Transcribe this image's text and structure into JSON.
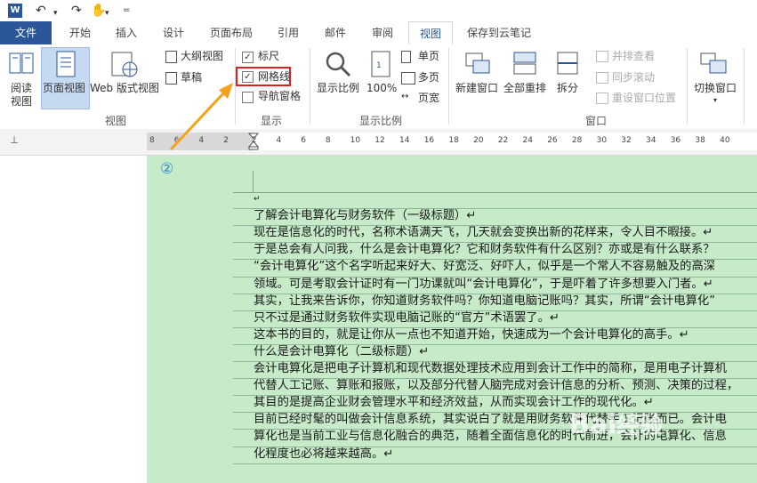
{
  "quick_access": {
    "undo": "↶",
    "redo": "↷",
    "touch": "✋",
    "more": "="
  },
  "tabs": [
    "文件",
    "开始",
    "插入",
    "设计",
    "页面布局",
    "引用",
    "邮件",
    "审阅",
    "视图",
    "保存到云笔记"
  ],
  "active_tab": "视图",
  "ribbon": {
    "views": {
      "read": "阅读\n视图",
      "print": "页面视图",
      "web": "Web 版式视图",
      "outline": "大纲视图",
      "draft": "草稿",
      "group": "视图"
    },
    "show": {
      "ruler": "标尺",
      "gridlines": "网格线",
      "nav": "导航窗格",
      "group": "显示",
      "ruler_checked": true,
      "gridlines_checked": true,
      "nav_checked": false
    },
    "zoom": {
      "zoom": "显示比例",
      "pct": "100%",
      "one": "单页",
      "multi": "多页",
      "width": "页宽",
      "group": "显示比例"
    },
    "window": {
      "new": "新建窗口",
      "arrange": "全部重排",
      "split": "拆分",
      "side": "并排查看",
      "sync": "同步滚动",
      "reset": "重设窗口位置",
      "switch": "切换窗口",
      "group": "窗口"
    }
  },
  "ruler": {
    "numbers": [
      "8",
      "6",
      "4",
      "2",
      "2",
      "4",
      "6",
      "8",
      "10",
      "12",
      "14",
      "16",
      "18",
      "20",
      "22",
      "24",
      "26",
      "28",
      "30",
      "32",
      "34",
      "36",
      "38",
      "40"
    ],
    "tab_marker": "⊥"
  },
  "annotation": {
    "step": "②"
  },
  "colors": {
    "file_tab": "#2b579a",
    "page_bg": "#c7ebc9",
    "highlight": "#e02020",
    "arrow": "#f5a21a"
  },
  "document": {
    "lines": [
      "↵",
      "了解会计电算化与财务软件（一级标题）↵",
      "现在是信息化的时代，名称术语满天飞，几天就会变换出新的花样来，令人目不暇接。↵",
      "于是总会有人问我，什么是会计电算化？它和财务软件有什么区别？亦或是有什么联系？",
      "“会计电算化”这个名字听起来好大、好宽泛、好吓人，似乎是一个常人不容易触及的高深",
      "领域。可是考取会计证时有一门功课就叫“会计电算化”，于是吓着了许多想要入门者。↵",
      "其实，让我来告诉你，你知道财务软件吗？你知道电脑记账吗？其实，所谓“会计电算化”",
      "只不过是通过财务软件实现电脑记账的“官方”术语罢了。↵",
      "这本书的目的，就是让你从一点也不知道开始，快速成为一个会计电算化的高手。↵",
      "什么是会计电算化（二级标题）↵",
      "会计电算化是把电子计算机和现代数据处理技术应用到会计工作中的简称，是用电子计算机",
      "代替人工记账、算账和报账，以及部分代替人脑完成对会计信息的分析、预测、决策的过程，",
      "其目的是提高企业财会管理水平和经济效益，从而实现会计工作的现代化。↵",
      "目前已经时髦的叫做会计信息系统，其实说白了就是用财务软件代替手工记账而已。会计电",
      "算化也是当前工业与信息化融合的典范，随着全面信息化的时代前进，会计的电算化、信息",
      "化程度也必将越来越高。↵"
    ]
  }
}
